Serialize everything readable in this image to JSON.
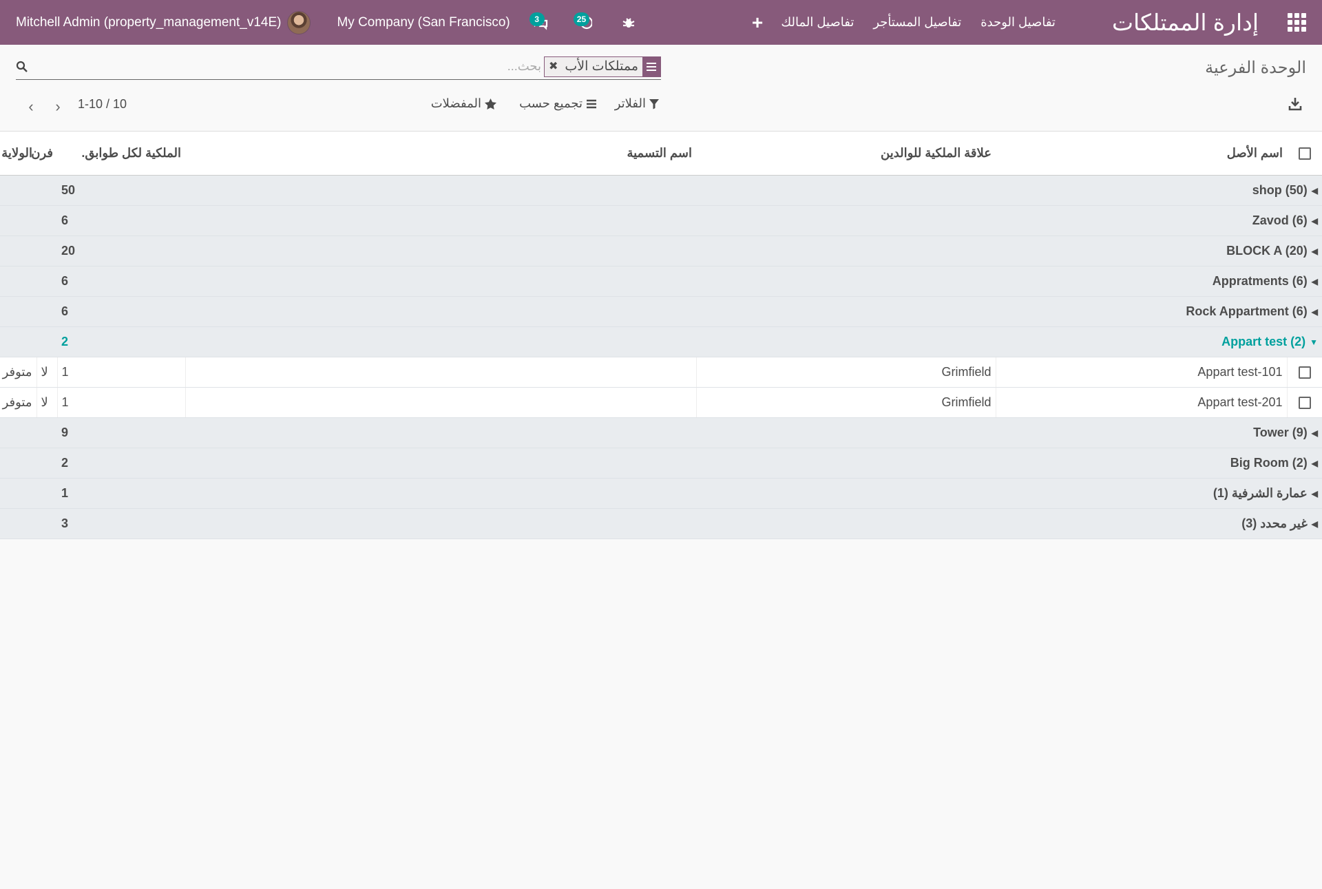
{
  "navbar": {
    "app_title": "إدارة الممتلكات",
    "menus": [
      "تفاصيل الوحدة",
      "تفاصيل المستأجر",
      "تفاصيل المالك"
    ],
    "user": "Mitchell Admin (property_management_v14E)",
    "company": "My Company (San Francisco)",
    "messages_count": "3",
    "activities_count": "25",
    "accent_color": "#875a7b",
    "badge_color": "#00a09d"
  },
  "control": {
    "breadcrumb": "الوحدة الفرعية",
    "facet_label": "ممتلكات الأب",
    "search_placeholder": "بحث...",
    "filters_label": "الفلاتر",
    "groupby_label": "تجميع حسب",
    "favorites_label": "المفضلات",
    "pager": "1-10 / 10"
  },
  "table": {
    "columns": [
      "اسم الأصل",
      "علاقة الملكية للوالدين",
      "اسم التسمية",
      "الملكية لكل طوابق.",
      "فرن",
      "الولاية"
    ],
    "groups": [
      {
        "name": "shop (50)",
        "value": "50"
      },
      {
        "name": "Zavod (6)",
        "value": "6"
      },
      {
        "name": "BLOCK A (20)",
        "value": "20"
      },
      {
        "name": "Appratments (6)",
        "value": "6"
      },
      {
        "name": "Rock Appartment (6)",
        "value": "6"
      },
      {
        "name": "Appart test (2)",
        "value": "2"
      },
      {
        "name": "Tower (9)",
        "value": "9"
      },
      {
        "name": "Big Room (2)",
        "value": "2"
      },
      {
        "name": "عمارة الشرفية (1)",
        "value": "1"
      },
      {
        "name": "غير محدد (3)",
        "value": "3"
      }
    ],
    "records": [
      {
        "name": "Appart test-101",
        "parent": "Grimfield",
        "label": "",
        "floors": "1",
        "oven": "لا",
        "state": "متوفر"
      },
      {
        "name": "Appart test-201",
        "parent": "Grimfield",
        "label": "",
        "floors": "1",
        "oven": "لا",
        "state": "متوفر"
      }
    ]
  }
}
